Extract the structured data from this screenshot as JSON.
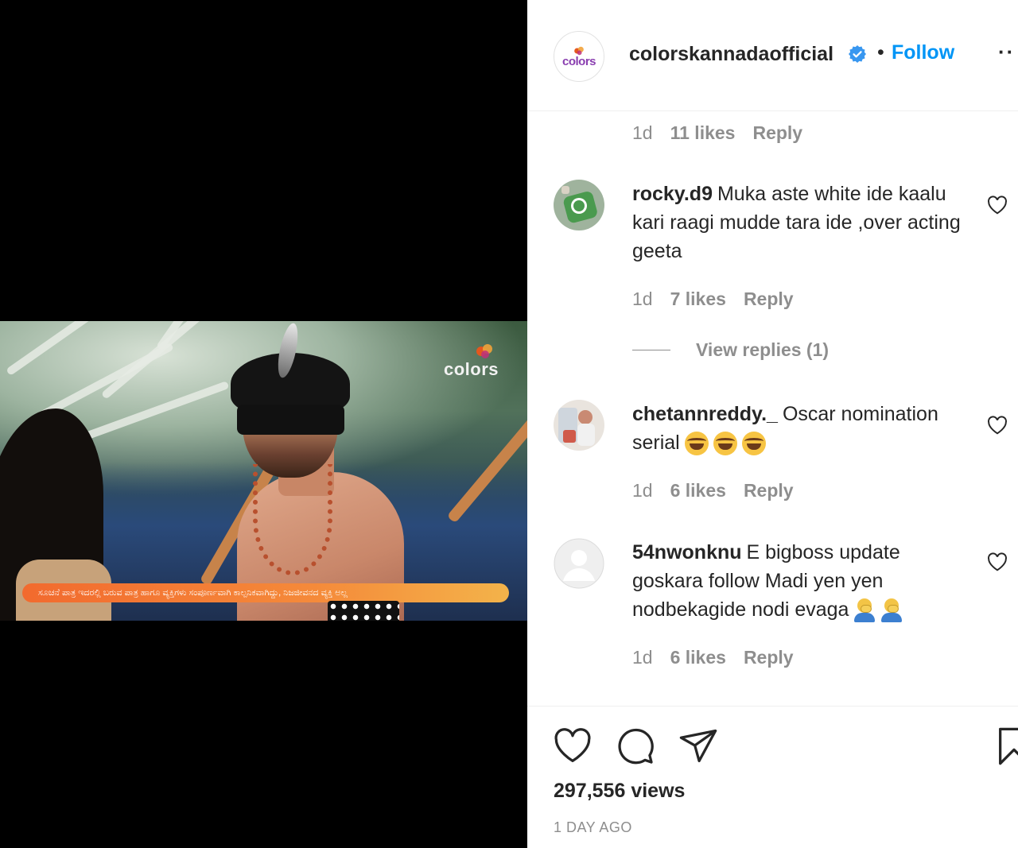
{
  "colors": {
    "accent": "#0095f6",
    "text_primary": "#262626",
    "text_secondary": "#8e8e8e",
    "verified": "#3897f0",
    "media_bg": "#000000"
  },
  "header": {
    "avatar_logo_text": "colors",
    "username": "colorskannada official",
    "username_display": "colorskannadaofficial",
    "separator": "•",
    "follow_label": "Follow",
    "more_icon": "more-horizontal-icon",
    "more_label": "··"
  },
  "media": {
    "logo_text": "colors",
    "banner_text": "ಸೂಚನೆ ಪಾತ್ರ ಇದರಲ್ಲಿ ಬರುವ ಪಾತ್ರ ಹಾಗೂ ವ್ಯಕ್ತಿಗಳು ಸಂಪೂರ್ಣವಾಗಿ ಕಾಲ್ಪನಿಕವಾಗಿದ್ದು, ನಿಜಜೀವನದ ವ್ಯಕ್ತಿ ಅಲ್ಲ"
  },
  "prev_comment_meta": {
    "time": "1d",
    "likes": "11 likes",
    "reply": "Reply"
  },
  "comments": [
    {
      "username": "rocky.d9",
      "text": "Muka aste white ide kaalu kari raagi mudde tara ide ,over acting geeta",
      "emoji": [],
      "time": "1d",
      "likes": "7 likes",
      "reply": "Reply",
      "view_replies": "View replies (1)"
    },
    {
      "username": "chetannreddy._",
      "text": "Oscar nomination serial",
      "emoji": [
        "joy-emoji",
        "joy-emoji",
        "joy-emoji"
      ],
      "time": "1d",
      "likes": "6 likes",
      "reply": "Reply"
    },
    {
      "username": "54nwonknu",
      "text": "E bigboss update goskara follow Madi yen yen nodbekagide nodi evaga",
      "emoji": [
        "facepalm-emoji",
        "facepalm-emoji"
      ],
      "time": "1d",
      "likes": "6 likes",
      "reply": "Reply"
    }
  ],
  "footer": {
    "actions": [
      "heart-icon",
      "comment-icon",
      "share-icon",
      "bookmark-icon"
    ],
    "views": "297,556 views",
    "date": "1 DAY AGO"
  }
}
